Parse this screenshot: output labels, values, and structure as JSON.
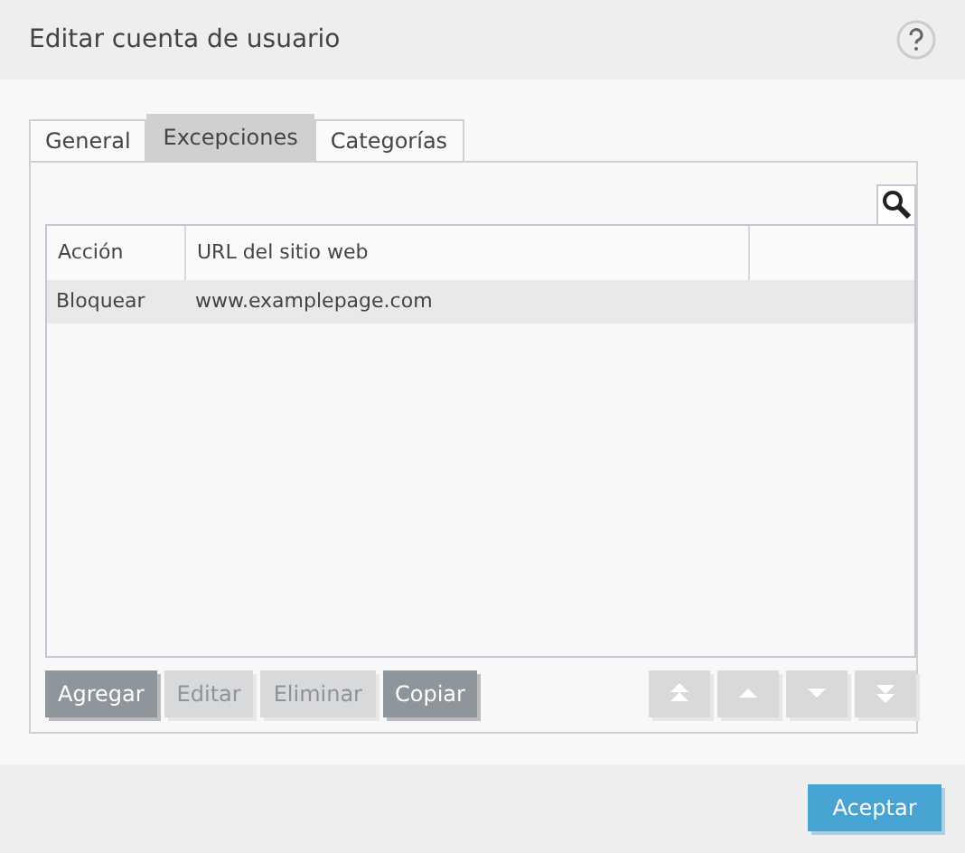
{
  "window": {
    "title": "Editar cuenta de usuario"
  },
  "tabs": [
    {
      "label": "General",
      "selected": false
    },
    {
      "label": "Excepciones",
      "selected": true
    },
    {
      "label": "Categorías",
      "selected": false
    }
  ],
  "table": {
    "columns": [
      "Acción",
      "URL del sitio web"
    ],
    "rows": [
      {
        "cells": [
          "Bloquear",
          "www.examplepage.com"
        ],
        "selected": true
      }
    ]
  },
  "buttons": [
    {
      "label": "Agregar",
      "disabled": false
    },
    {
      "label": "Editar",
      "disabled": true
    },
    {
      "label": "Eliminar",
      "disabled": true
    },
    {
      "label": "Copiar",
      "disabled": false
    }
  ],
  "move_buttons": [
    {
      "kind": "top",
      "disabled": true
    },
    {
      "kind": "up",
      "disabled": true
    },
    {
      "kind": "down",
      "disabled": true
    },
    {
      "kind": "bottom",
      "disabled": true
    }
  ],
  "footer": {
    "button": "Aceptar"
  }
}
